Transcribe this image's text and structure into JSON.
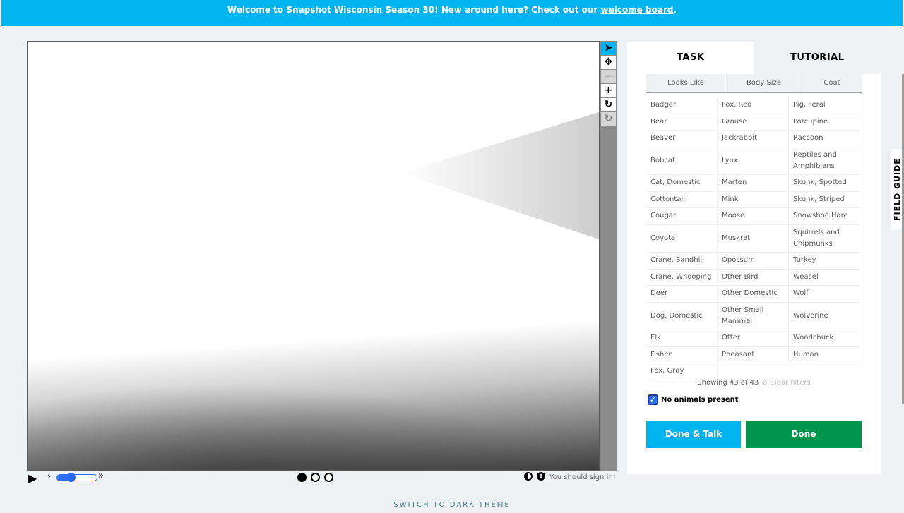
{
  "banner": {
    "text": "Welcome to Snapshot Wisconsin Season 30! New around here? Check out our ",
    "link": "welcome board",
    "suffix": "."
  },
  "toolbar": {
    "tools": [
      {
        "name": "annotate",
        "glyph": "➤",
        "state": "active"
      },
      {
        "name": "move",
        "glyph": "✥",
        "state": "normal"
      },
      {
        "name": "zoom-out",
        "glyph": "−",
        "state": "disabled"
      },
      {
        "name": "zoom-in",
        "glyph": "+",
        "state": "normal"
      },
      {
        "name": "rotate",
        "glyph": "↻",
        "state": "normal"
      },
      {
        "name": "reset",
        "glyph": "↻",
        "state": "disabled"
      }
    ]
  },
  "player": {
    "speed_lt": "›",
    "speed_gt": "»",
    "speed_level": 0.25,
    "frames_total": 3,
    "frame_current": 1
  },
  "signin": "You should sign in!",
  "tabs": {
    "task": "TASK",
    "tutorial": "TUTORIAL"
  },
  "filters": {
    "looks_like": "Looks Like",
    "body_size": "Body Size",
    "coat": "Coat"
  },
  "choices": {
    "col0": [
      "Badger",
      "Bear",
      "Beaver",
      "Bobcat",
      "Cat, Domestic",
      "Cottontail",
      "Cougar",
      "Coyote",
      "Crane, Sandhill",
      "Crane, Whooping",
      "Deer",
      "Dog, Domestic",
      "Elk",
      "Fisher",
      "Fox, Gray"
    ],
    "col1": [
      "Fox, Red",
      "Grouse",
      "Jackrabbit",
      "Lynx",
      "Marten",
      "Mink",
      "Moose",
      "Muskrat",
      "Opossum",
      "Other Bird",
      "Other Domestic",
      "Other Small Mammal",
      "Otter",
      "Pheasant"
    ],
    "col2": [
      "Pig, Feral",
      "Porcupine",
      "Raccoon",
      "Reptiles and Amphibians",
      "Skunk, Spotted",
      "Skunk, Striped",
      "Snowshoe Hare",
      "Squirrels and Chipmunks",
      "Turkey",
      "Weasel",
      "Wolf",
      "Wolverine",
      "Woodchuck",
      "Human"
    ]
  },
  "showing": "Showing 43 of 43",
  "clear_filters": "⊘ Clear filters",
  "no_animals": {
    "label": "No animals present",
    "checked": true
  },
  "buttons": {
    "done_talk": "Done & Talk",
    "done": "Done"
  },
  "field_guide": "FIELD GUIDE",
  "theme_toggle": "SWITCH TO DARK THEME",
  "colors": {
    "banner": "#00b4f0",
    "done_talk": "#00b4f0",
    "done": "#00954c",
    "accent_blue": "#2b6cf5"
  }
}
